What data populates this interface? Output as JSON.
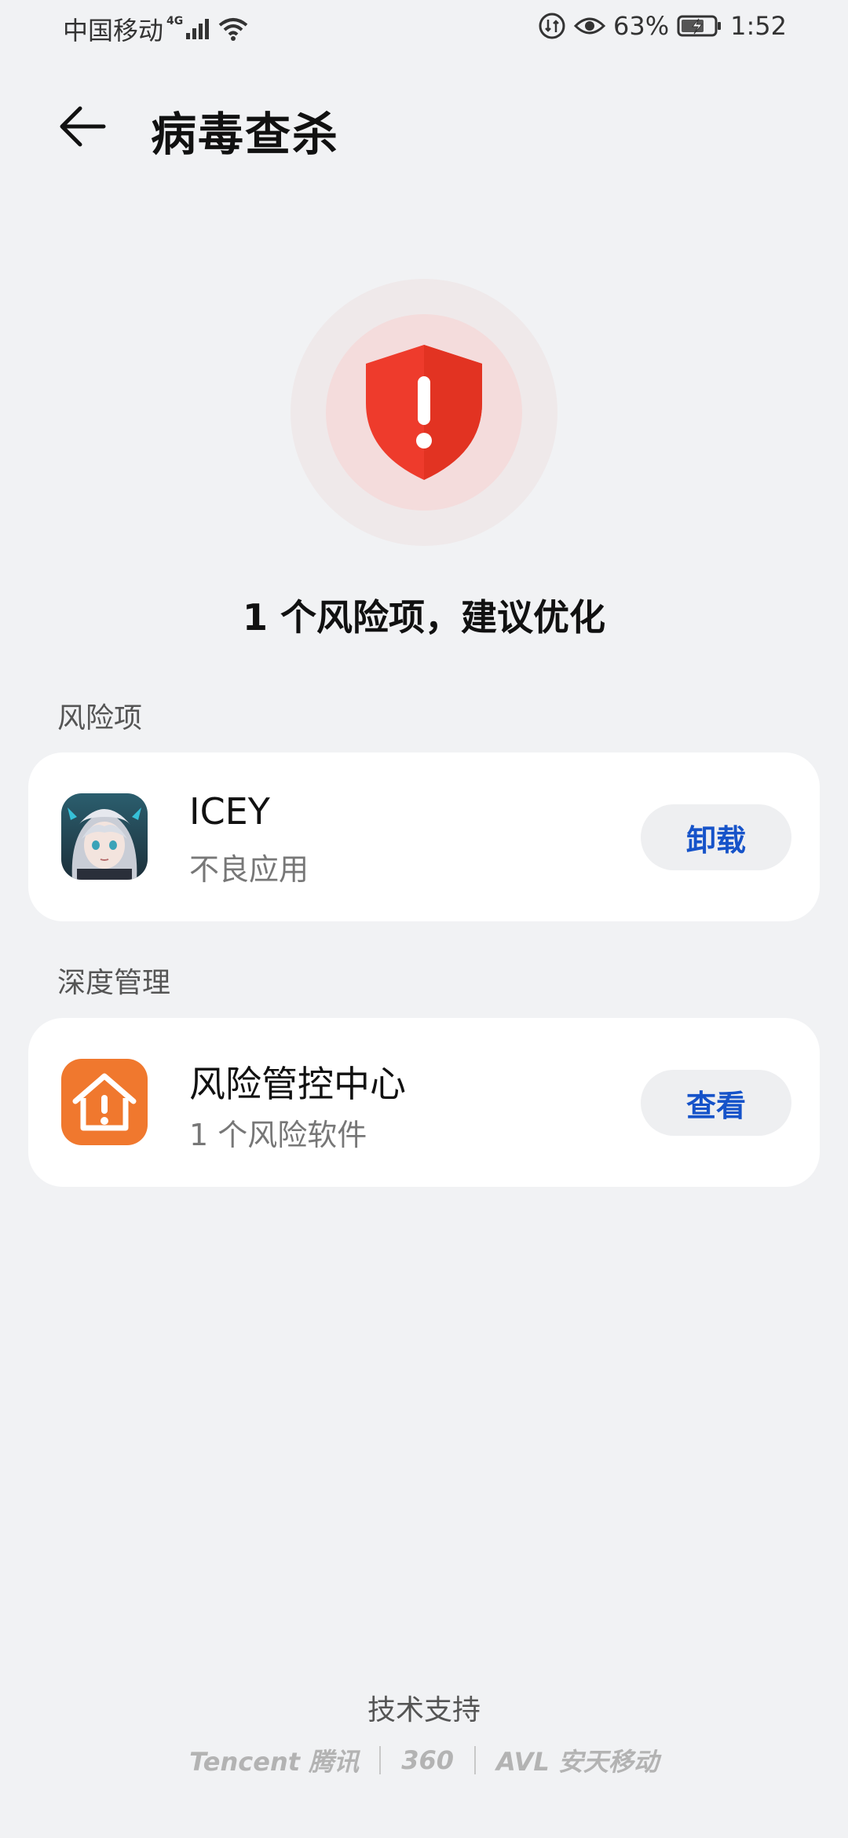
{
  "status": {
    "carrier": "中国移动",
    "network": "4G",
    "battery": "63%",
    "time": "1:52"
  },
  "header": {
    "title": "病毒查杀"
  },
  "summary": {
    "text": "1 个风险项，建议优化"
  },
  "risk_section": {
    "label": "风险项",
    "item": {
      "name": "ICEY",
      "desc": "不良应用",
      "action": "卸载"
    }
  },
  "deep_section": {
    "label": "深度管理",
    "item": {
      "name": "风险管控中心",
      "desc": "1 个风险软件",
      "action": "查看"
    }
  },
  "footer": {
    "label": "技术支持",
    "partners": [
      "Tencent 腾讯",
      "360",
      "AVL 安天移动"
    ]
  },
  "colors": {
    "accent": "#1653c9",
    "danger": "#ee3b2c",
    "orange": "#f0782e"
  }
}
